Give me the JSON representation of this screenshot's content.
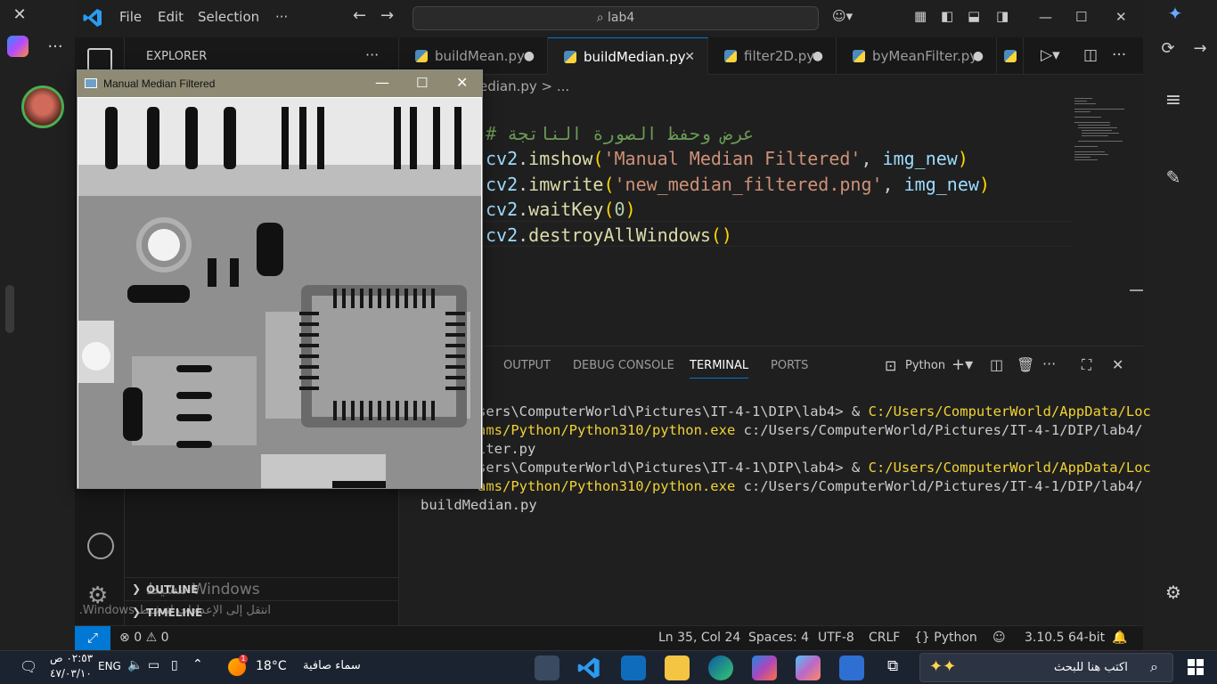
{
  "vscode": {
    "menu": [
      "File",
      "Edit",
      "Selection",
      "···"
    ],
    "search_placeholder": "lab4",
    "explorer_label": "EXPLORER",
    "tabs": [
      {
        "label": "buildMean.py",
        "modified": "●"
      },
      {
        "label": "buildMedian.py",
        "close": "✕"
      },
      {
        "label": "filter2D.py",
        "modified": "●"
      },
      {
        "label": "byMeanFilter.py",
        "modified": "●"
      }
    ],
    "breadcrumb": "edian.py > ...",
    "code_comment": "# عرض وحفظ الصورة الناتجة",
    "code_lines": [
      "cv2.imshow('Manual Median Filtered', img_new)",
      "cv2.imwrite('new_median_filtered.png', img_new)",
      "cv2.waitKey(0)",
      "cv2.destroyAllWindows()"
    ],
    "panel_tabs": [
      "OUTPUT",
      "DEBUG CONSOLE",
      "TERMINAL",
      "PORTS"
    ],
    "active_panel_tab": "TERMINAL",
    "terminal_profile": "Python",
    "terminal": {
      "l1_a": "sers\\ComputerWorld\\Pictures\\IT-4-1\\DIP\\lab4> & ",
      "l1_b": "C:/Users/ComputerWorld/AppData/Loc",
      "l2_a": "ams/Python/Python310/python.exe",
      "l2_b": " c:/Users/ComputerWorld/Pictures/IT-4-1/DIP/lab4/",
      "l3": "lter.py",
      "l4_a": "sers\\ComputerWorld\\Pictures\\IT-4-1\\DIP\\lab4> & ",
      "l4_b": "C:/Users/ComputerWorld/AppData/Loc",
      "l5_a": "ams/Python/Python310/python.exe",
      "l5_b": " c:/Users/ComputerWorld/Pictures/IT-4-1/DIP/lab4/",
      "l6": "buildMedian.py"
    },
    "outline_label": "OUTLINE",
    "timeline_label": "TIMELINE",
    "activation_title": "تنشيط Windows",
    "activation_sub": "انتقل إلى الإعدادات لتنشيط Windows.",
    "status": {
      "errors": "0",
      "warnings": "0",
      "position": "Ln 35, Col 24",
      "spaces": "Spaces: 4",
      "encoding": "UTF-8",
      "eol": "CRLF",
      "language": "Python",
      "interpreter": "3.10.5 64-bit"
    }
  },
  "cv_window": {
    "title": "Manual Median Filtered"
  },
  "taskbar": {
    "time": "٠٢:٥٣ ص",
    "date": "٤٧/٠٣/١٠",
    "lang": "ENG",
    "temperature": "18°C",
    "weather": "سماء صافية",
    "weather_badge": "1",
    "search_placeholder": "اكتب هنا للبحث"
  },
  "colors": {
    "vscode_bg": "#1f1f1f",
    "accent": "#0078d4",
    "string": "#ce9178",
    "function": "#dcdcaa",
    "variable": "#9cdcfe",
    "comment": "#6a9955",
    "number": "#b5cea8",
    "terminal_yellow": "#f1d335"
  }
}
